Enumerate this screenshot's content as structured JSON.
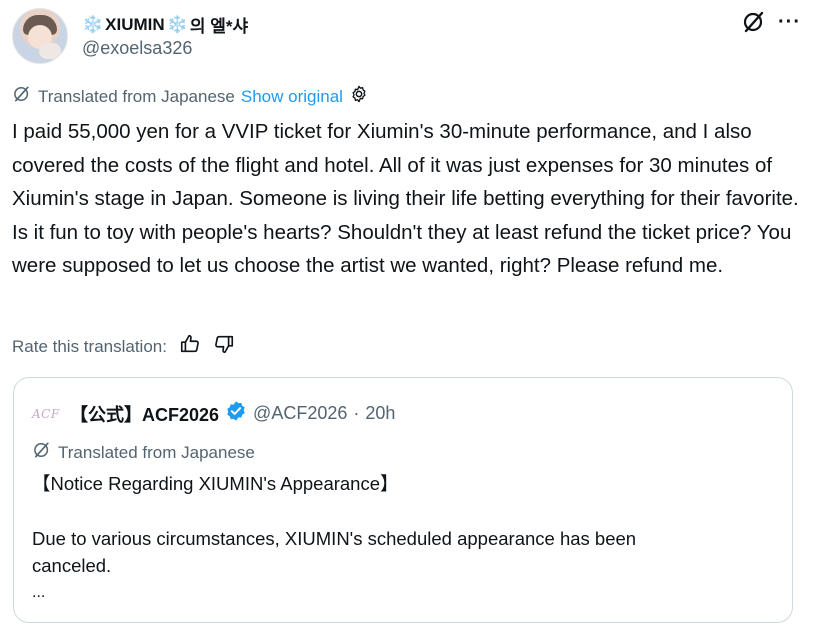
{
  "author": {
    "display_prefix": "❄️",
    "display_name": "XIUMIN",
    "display_mid": "❄️",
    "display_suffix": "의 엘*샤",
    "handle": "@exoelsa326"
  },
  "translation": {
    "label": "Translated from Japanese",
    "show_original": "Show original"
  },
  "tweet": {
    "text": "I paid 55,000 yen for a VVIP ticket for Xiumin's 30-minute performance, and I also covered the costs of the flight and hotel. All of it was just expenses for 30 minutes of Xiumin's stage in Japan. Someone is living their life betting everything for their favorite. Is it fun to toy with people's hearts? Shouldn't they at least refund the ticket price? You were supposed to let us choose the artist we wanted, right? Please refund me."
  },
  "rate": {
    "label": "Rate this translation:"
  },
  "quote": {
    "logo_text": "ACF",
    "name": "【公式】ACF2026",
    "handle": "@ACF2026",
    "separator": "·",
    "time": "20h",
    "translated_label": "Translated from Japanese",
    "title": "【Notice Regarding XIUMIN's Appearance】",
    "body_line1": "Due to various circumstances, XIUMIN's scheduled appearance has been",
    "body_line2": "canceled.",
    "ellipsis": "..."
  },
  "colors": {
    "link": "#1d9bf0",
    "muted": "#536471",
    "verified": "#1d9bf0",
    "border": "#cfd9de"
  }
}
